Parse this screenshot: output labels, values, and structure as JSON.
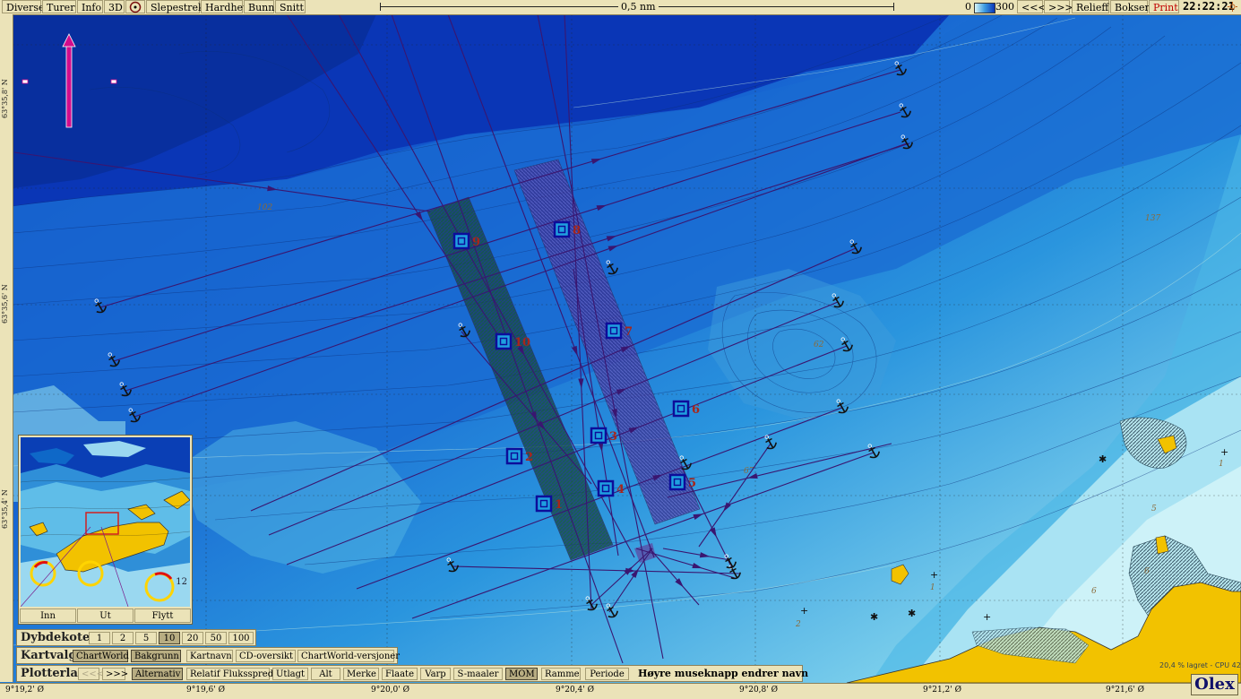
{
  "top_menu": [
    "Diverse",
    "Turer",
    "Info",
    "3D",
    "Slepestrek",
    "Hardhet",
    "Bunn",
    "Snitt"
  ],
  "scale": {
    "label": "0,5 nm"
  },
  "depth_legend": {
    "min": "0",
    "max": "300"
  },
  "top_right_buttons": [
    "<<<",
    ">>>",
    "Relieff",
    "Bokser",
    "Print"
  ],
  "clock": "22:22:21",
  "lat_labels": [
    "63°35,8' N",
    "63°35,6' N",
    "63°35,4' N"
  ],
  "lon_labels": [
    "9°19,2' Ø",
    "9°19,6' Ø",
    "9°20,0' Ø",
    "9°20,4' Ø",
    "9°20,8' Ø",
    "9°21,2' Ø",
    "9°21,6' Ø"
  ],
  "waypoints": [
    "1",
    "2",
    "3",
    "4",
    "5",
    "6",
    "7",
    "8",
    "9",
    "10"
  ],
  "depth_soundings": [
    "102",
    "137",
    "62",
    "67",
    "12",
    "5",
    "6",
    "6",
    "1",
    "2",
    "1"
  ],
  "minimap": {
    "buttons": [
      "Inn",
      "Ut",
      "Flytt"
    ],
    "depth_12": "12"
  },
  "dybdekoter": {
    "title": "Dybdekoter",
    "options": [
      "1",
      "2",
      "5",
      "10",
      "20",
      "50",
      "100"
    ],
    "selected": "10"
  },
  "kartvalg": {
    "title": "Kartvalg",
    "options": [
      "ChartWorld",
      "Bakgrunn",
      "Kartnavn",
      "CD-oversikt",
      "ChartWorld-versjoner"
    ],
    "active": [
      "ChartWorld",
      "Bakgrunn"
    ]
  },
  "plotterlag": {
    "title": "Plotterlag",
    "nav": [
      "<<<",
      ">>>"
    ],
    "options": [
      "Alternativ",
      "Relatif Fluksspred",
      "Utlagt",
      "Alt",
      "Merke",
      "Flaate",
      "Varp",
      "S-maaler",
      "MOM",
      "Ramme",
      "Periode"
    ],
    "active": [
      "Alternativ",
      "MOM"
    ],
    "hint": "Høyre museknapp endrer navn"
  },
  "status": "20,4 % lagret - CPU 42°C",
  "brand": "Olex",
  "colors": {
    "deep": "#0b3fc0",
    "shallow": "#c9f1f7",
    "land": "#f2c200",
    "track": "#3a1a7a",
    "panel": "#ebe3b8",
    "waypoint": "#0d0d9a",
    "label": "#a8261a"
  }
}
